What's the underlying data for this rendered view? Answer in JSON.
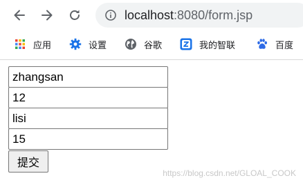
{
  "browser": {
    "url_host": "localhost",
    "url_rest": ":8080/form.jsp"
  },
  "bookmarks": [
    {
      "label": "应用",
      "icon": "apps-grid-icon"
    },
    {
      "label": "设置",
      "icon": "gear-icon"
    },
    {
      "label": "谷歌",
      "icon": "globe-icon"
    },
    {
      "label": "我的智联",
      "icon": "zhilian-logo-icon"
    },
    {
      "label": "百度",
      "icon": "baidu-paw-icon"
    }
  ],
  "form": {
    "field1": "zhangsan",
    "field2": "12",
    "field3": "lisi",
    "field4": "15",
    "submit_label": "提交"
  },
  "watermark": "https://blog.csdn.net/GLOAL_COOK",
  "colors": {
    "accent": "#1a73e8",
    "omnibox_bg": "#f1f3f4",
    "icon_gray": "#5f6368"
  }
}
